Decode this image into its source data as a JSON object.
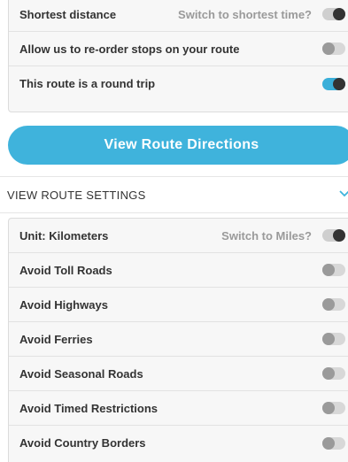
{
  "route_options": [
    {
      "label": "Shortest distance",
      "link": "Switch to shortest time?",
      "toggle_on": true
    },
    {
      "label": "Allow us to re-order stops on your route",
      "toggle_on": false
    },
    {
      "label": "This route is a round trip",
      "toggle_on": true
    }
  ],
  "directions_button": "View Route Directions",
  "settings_header": "VIEW ROUTE SETTINGS",
  "settings": {
    "unit": {
      "label": "Unit: Kilometers",
      "link": "Switch to Miles?",
      "toggle_on": true
    },
    "avoid": [
      {
        "label": "Avoid Toll Roads",
        "toggle_on": false
      },
      {
        "label": "Avoid Highways",
        "toggle_on": false
      },
      {
        "label": "Avoid Ferries",
        "toggle_on": false
      },
      {
        "label": "Avoid Seasonal Roads",
        "toggle_on": false
      },
      {
        "label": "Avoid Timed Restrictions",
        "toggle_on": false
      },
      {
        "label": "Avoid Country Borders",
        "toggle_on": false
      }
    ]
  },
  "icons": {
    "header_chevron": "chevron-down-icon"
  },
  "colors": {
    "accent": "#3fb3dc",
    "toggle_knob_dark": "#333333",
    "toggle_off": "#9a9a9a"
  }
}
